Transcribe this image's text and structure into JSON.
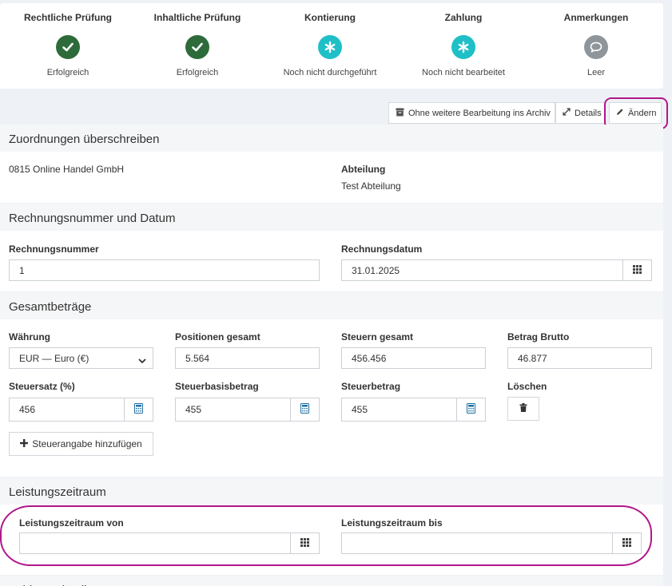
{
  "status_steps": [
    {
      "title": "Rechtliche Prüfung",
      "status": "Erfolgreich",
      "icon": "check-icon"
    },
    {
      "title": "Inhaltliche Prüfung",
      "status": "Erfolgreich",
      "icon": "check-icon"
    },
    {
      "title": "Kontierung",
      "status": "Noch nicht durchgeführt",
      "icon": "asterisk-icon"
    },
    {
      "title": "Zahlung",
      "status": "Noch nicht bearbeitet",
      "icon": "asterisk-icon"
    },
    {
      "title": "Anmerkungen",
      "status": "Leer",
      "icon": "comment-icon"
    }
  ],
  "toolbar": {
    "archive_label": "Ohne weitere Bearbeitung ins Archiv",
    "details_label": "Details",
    "edit_label": "Ändern"
  },
  "assignments": {
    "heading": "Zuordnungen überschreiben",
    "company": "0815 Online Handel GmbH",
    "department_label": "Abteilung",
    "department_value": "Test Abteilung"
  },
  "invoice": {
    "heading": "Rechnungsnummer und Datum",
    "number_label": "Rechnungsnummer",
    "number_value": "1",
    "date_label": "Rechnungsdatum",
    "date_value": "31.01.2025"
  },
  "totals": {
    "heading": "Gesamtbeträge",
    "currency_label": "Währung",
    "currency_value": "EUR — Euro (€)",
    "positions_label": "Positionen gesamt",
    "positions_value": "5.564",
    "taxes_label": "Steuern gesamt",
    "taxes_value": "456.456",
    "gross_label": "Betrag Brutto",
    "gross_value": "46.877",
    "tax_rate_label": "Steuersatz (%)",
    "tax_rate_value": "456",
    "tax_base_label": "Steuerbasisbetrag",
    "tax_base_value": "455",
    "tax_amount_label": "Steuerbetrag",
    "tax_amount_value": "455",
    "delete_label": "Löschen",
    "add_tax_label": "Steuerangabe hinzufügen"
  },
  "service_period": {
    "heading": "Leistungszeitraum",
    "from_label": "Leistungszeitraum von",
    "from_value": "",
    "to_label": "Leistungszeitraum bis",
    "to_value": ""
  },
  "next_section_heading": "Zahlungsdetails",
  "colors": {
    "success": "#2e6b3a",
    "pending": "#1fbfc7",
    "neutral": "#8e959b",
    "highlight": "#b1168a"
  }
}
